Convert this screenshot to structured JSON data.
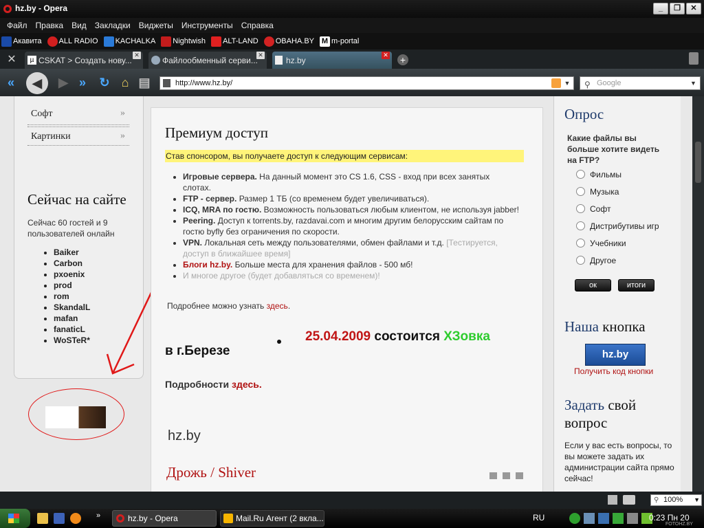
{
  "window": {
    "title": "hz.by - Opera"
  },
  "menu": [
    "Файл",
    "Правка",
    "Вид",
    "Закладки",
    "Виджеты",
    "Инструменты",
    "Справка"
  ],
  "bookmarks": [
    {
      "label": "Акавита",
      "icon": "akavita-icon",
      "color": "#1a4aa8"
    },
    {
      "label": "ALL RADIO",
      "icon": "opera-icon",
      "color": "#d21f1f"
    },
    {
      "label": "KACHALKA",
      "icon": "kachalka-icon",
      "color": "#2a7ad8"
    },
    {
      "label": "Nightwish",
      "icon": "nightwish-icon",
      "color": "#c31c1c"
    },
    {
      "label": "ALT-LAND",
      "icon": "altland-icon",
      "color": "#e02020"
    },
    {
      "label": "OBAHA.BY",
      "icon": "obaha-icon",
      "color": "#d22222"
    },
    {
      "label": "m-portal",
      "icon": "mportal-icon",
      "color": "#333333"
    }
  ],
  "tabs": [
    {
      "label": "CSKAT > Создать нову...",
      "icon": "utorrent-icon",
      "active": false
    },
    {
      "label": "Файлообменный серви...",
      "icon": "globe-icon",
      "active": false
    },
    {
      "label": "hz.by",
      "icon": "page-icon",
      "active": true
    }
  ],
  "address": {
    "url": "http://www.hz.by/",
    "search_placeholder": "Google"
  },
  "left": {
    "nav": [
      {
        "label": "Софт",
        "arrow": "»"
      },
      {
        "label": "Картинки",
        "arrow": "»"
      }
    ],
    "online_title": "Сейчас на сайте",
    "online_text": "Сейчас 60 гостей и 9 пользователей онлайн",
    "users": [
      "Baiker",
      "Carbon",
      "pxoenix",
      "prod",
      "rom",
      "SkandalL",
      "mafan",
      "fanaticL",
      "WoSTeR*"
    ]
  },
  "main": {
    "title": "Премиум доступ",
    "highlight": "Став спонсором, вы получаете доступ к следующим сервисам:",
    "items": [
      {
        "bold": "Игровые сервера.",
        "text": " На данный момент это CS 1.6, CSS - вход при всех занятых слотах.",
        "muted": ""
      },
      {
        "bold": "FTP - сервер.",
        "text": " Размер 1 ТБ (со временем будет увеличиваться).",
        "muted": ""
      },
      {
        "bold": "ICQ, MRA по гостю.",
        "text": " Возможность пользоваться любым клиентом, не используя jabber!",
        "muted": ""
      },
      {
        "bold": "Peering.",
        "text": " Доступ к torrents.by, razdavai.com и многим другим белорусским сайтам по гостю byfly без ограничения по скорости.",
        "muted": ""
      },
      {
        "bold": "VPN.",
        "text": " Локальная сеть между пользователями, обмен файлами и т.д. ",
        "muted": "[Тестируется, доступ в ближайшее время]"
      },
      {
        "bold": "Блоги hz.by.",
        "text": " Больше места для хранения файлов - 500 мб!",
        "muted": "",
        "red": true
      },
      {
        "bold": "",
        "text": "",
        "muted": "И многое другое (будет добавляться со временем)!"
      }
    ],
    "more_text": "Подробнее можно узнать ",
    "more_link": "здесь",
    "more_dot": ".",
    "event_date": "25.04.2009",
    "event_mid": " состоится ",
    "event_name": "ХЗовка",
    "event_place": "в г.Березе",
    "details_text": "Подробности ",
    "details_link": "здесь.",
    "site_name": "hz.by",
    "next_title": "Дрожь / Shiver"
  },
  "right": {
    "poll_title": "Опрос",
    "poll_question": "Какие файлы вы больше хотите видеть на FTP?",
    "options": [
      "Фильмы",
      "Музыка",
      "Софт",
      "Дистрибутивы игр",
      "Учебники",
      "Другое"
    ],
    "ok_label": "ок",
    "results_label": "итоги",
    "button_title_a": "Наша",
    "button_title_b": " кнопка",
    "banner_text": "hz.by",
    "code_link": "Получить код кнопки",
    "ask_title_a": "Задать",
    "ask_title_b": " свой вопрос",
    "ask_text": "Если у вас есть вопросы, то вы можете задать их администрации сайта прямо сейчас!"
  },
  "status": {
    "zoom": "100%"
  },
  "taskbar": {
    "items": [
      {
        "label": "hz.by - Opera"
      },
      {
        "label": "Mail.Ru Агент (2 вкла..."
      }
    ],
    "lang": "RU",
    "clock": "0:23 Пн 20",
    "watermark": "FOTOHZ.BY"
  },
  "colors": {
    "accent_red": "#b01212",
    "event_green": "#2ecc2e",
    "highlight": "#fff47a"
  }
}
